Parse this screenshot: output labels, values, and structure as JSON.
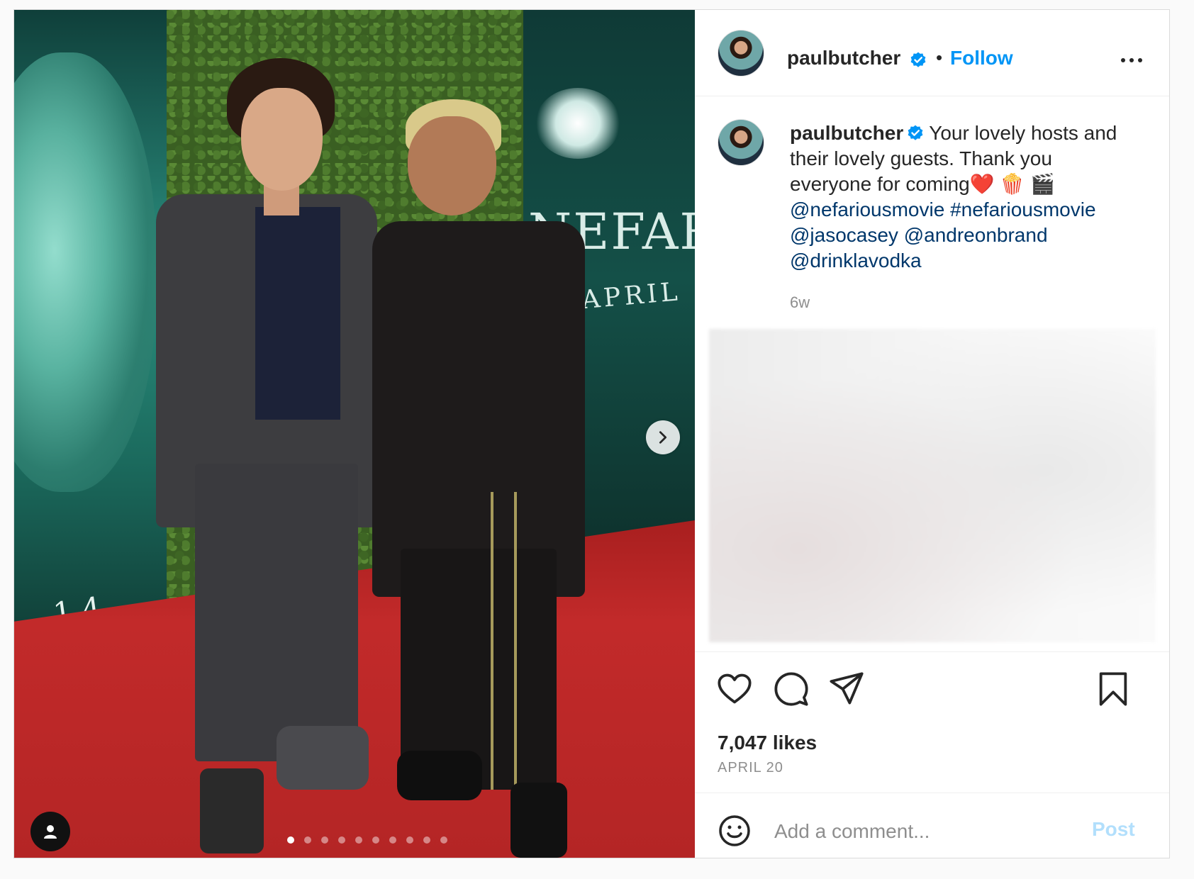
{
  "header": {
    "username": "paulbutcher",
    "separator": "•",
    "follow_label": "Follow"
  },
  "media": {
    "poster_title": "NEFARIO",
    "poster_date": "APRIL 14",
    "poster_date_left": "14",
    "carousel_total": 10,
    "carousel_active_index": 1
  },
  "caption": {
    "username": "paulbutcher",
    "text": "Your lovely hosts and their lovely guests. Thank you everyone for coming❤️ 🍿 🎬",
    "mentions": [
      "@nefariousmovie",
      "#nefariousmovie",
      "@jasocasey",
      "@andreonbrand",
      "@drinklavodka"
    ],
    "time_ago": "6w"
  },
  "engagement": {
    "likes": "7,047 likes",
    "date": "APRIL 20"
  },
  "comment": {
    "placeholder": "Add a comment...",
    "post_label": "Post"
  },
  "colors": {
    "accent": "#0095f6",
    "link": "#00376b",
    "post_disabled": "#b2dffc",
    "verified": "#0095f6"
  },
  "icons": [
    "verified-badge-icon",
    "more-options-icon",
    "heart-icon",
    "comment-icon",
    "share-icon",
    "bookmark-icon",
    "emoji-icon",
    "chevron-right-icon",
    "user-tag-icon"
  ]
}
